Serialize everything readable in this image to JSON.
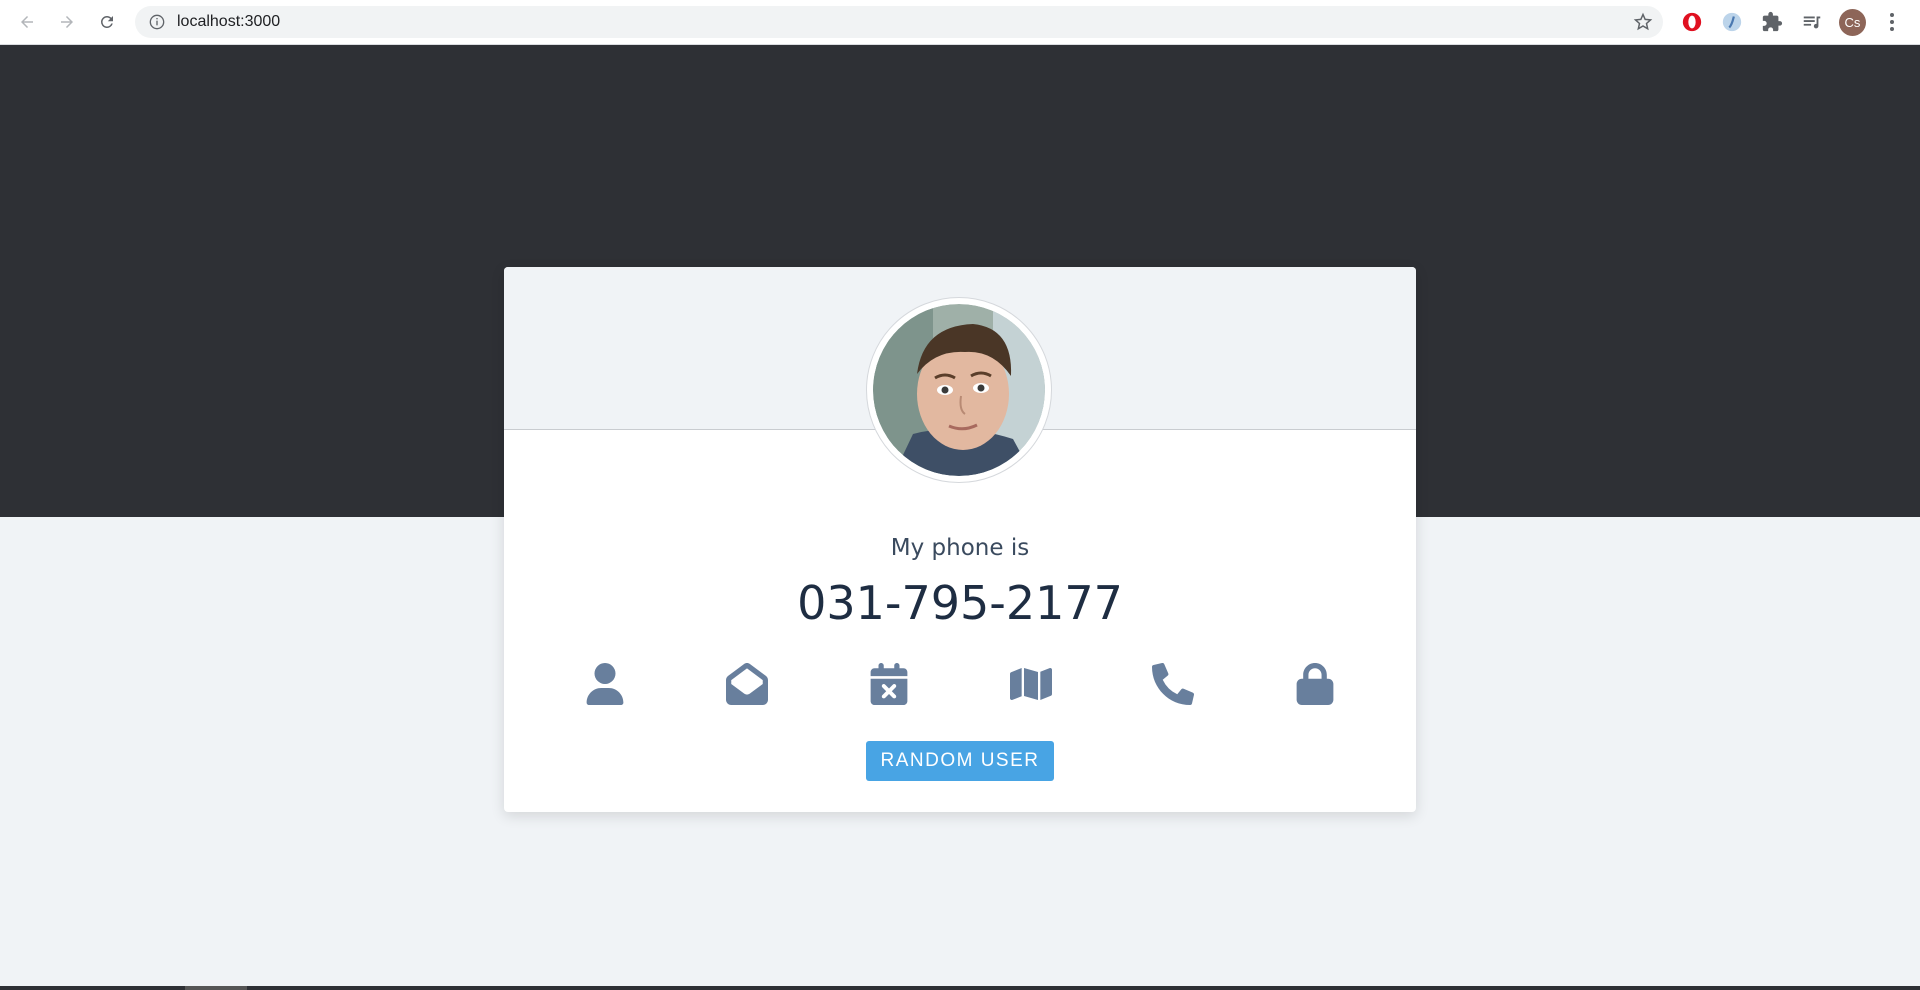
{
  "browser": {
    "url": "localhost:3000",
    "profile_initials": "Cs"
  },
  "card": {
    "label": "My phone is",
    "value": "031-795-2177",
    "button_label": "RANDOM USER",
    "icons": [
      "user-icon",
      "envelope-open-icon",
      "calendar-times-icon",
      "map-icon",
      "phone-icon",
      "lock-icon"
    ],
    "icon_color": "#687f9d",
    "button_color": "#48a4e4"
  },
  "colors": {
    "hero_bg": "#2e3035",
    "page_bg": "#f0f3f6"
  }
}
